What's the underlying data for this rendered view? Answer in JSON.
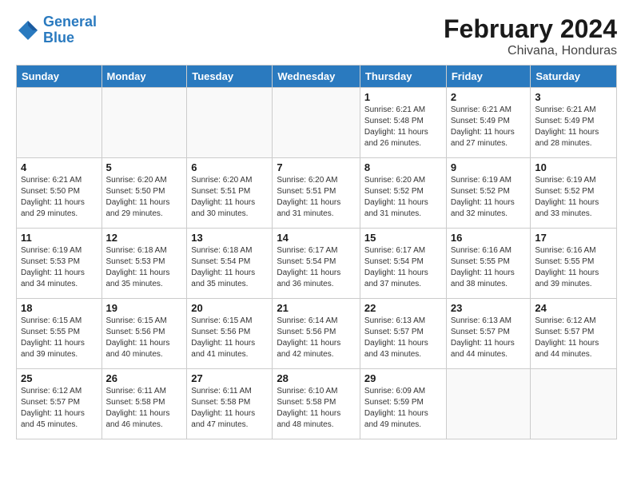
{
  "logo": {
    "line1": "General",
    "line2": "Blue"
  },
  "title": "February 2024",
  "subtitle": "Chivana, Honduras",
  "days_of_week": [
    "Sunday",
    "Monday",
    "Tuesday",
    "Wednesday",
    "Thursday",
    "Friday",
    "Saturday"
  ],
  "weeks": [
    [
      {
        "day": "",
        "info": ""
      },
      {
        "day": "",
        "info": ""
      },
      {
        "day": "",
        "info": ""
      },
      {
        "day": "",
        "info": ""
      },
      {
        "day": "1",
        "info": "Sunrise: 6:21 AM\nSunset: 5:48 PM\nDaylight: 11 hours and 26 minutes."
      },
      {
        "day": "2",
        "info": "Sunrise: 6:21 AM\nSunset: 5:49 PM\nDaylight: 11 hours and 27 minutes."
      },
      {
        "day": "3",
        "info": "Sunrise: 6:21 AM\nSunset: 5:49 PM\nDaylight: 11 hours and 28 minutes."
      }
    ],
    [
      {
        "day": "4",
        "info": "Sunrise: 6:21 AM\nSunset: 5:50 PM\nDaylight: 11 hours and 29 minutes."
      },
      {
        "day": "5",
        "info": "Sunrise: 6:20 AM\nSunset: 5:50 PM\nDaylight: 11 hours and 29 minutes."
      },
      {
        "day": "6",
        "info": "Sunrise: 6:20 AM\nSunset: 5:51 PM\nDaylight: 11 hours and 30 minutes."
      },
      {
        "day": "7",
        "info": "Sunrise: 6:20 AM\nSunset: 5:51 PM\nDaylight: 11 hours and 31 minutes."
      },
      {
        "day": "8",
        "info": "Sunrise: 6:20 AM\nSunset: 5:52 PM\nDaylight: 11 hours and 31 minutes."
      },
      {
        "day": "9",
        "info": "Sunrise: 6:19 AM\nSunset: 5:52 PM\nDaylight: 11 hours and 32 minutes."
      },
      {
        "day": "10",
        "info": "Sunrise: 6:19 AM\nSunset: 5:52 PM\nDaylight: 11 hours and 33 minutes."
      }
    ],
    [
      {
        "day": "11",
        "info": "Sunrise: 6:19 AM\nSunset: 5:53 PM\nDaylight: 11 hours and 34 minutes."
      },
      {
        "day": "12",
        "info": "Sunrise: 6:18 AM\nSunset: 5:53 PM\nDaylight: 11 hours and 35 minutes."
      },
      {
        "day": "13",
        "info": "Sunrise: 6:18 AM\nSunset: 5:54 PM\nDaylight: 11 hours and 35 minutes."
      },
      {
        "day": "14",
        "info": "Sunrise: 6:17 AM\nSunset: 5:54 PM\nDaylight: 11 hours and 36 minutes."
      },
      {
        "day": "15",
        "info": "Sunrise: 6:17 AM\nSunset: 5:54 PM\nDaylight: 11 hours and 37 minutes."
      },
      {
        "day": "16",
        "info": "Sunrise: 6:16 AM\nSunset: 5:55 PM\nDaylight: 11 hours and 38 minutes."
      },
      {
        "day": "17",
        "info": "Sunrise: 6:16 AM\nSunset: 5:55 PM\nDaylight: 11 hours and 39 minutes."
      }
    ],
    [
      {
        "day": "18",
        "info": "Sunrise: 6:15 AM\nSunset: 5:55 PM\nDaylight: 11 hours and 39 minutes."
      },
      {
        "day": "19",
        "info": "Sunrise: 6:15 AM\nSunset: 5:56 PM\nDaylight: 11 hours and 40 minutes."
      },
      {
        "day": "20",
        "info": "Sunrise: 6:15 AM\nSunset: 5:56 PM\nDaylight: 11 hours and 41 minutes."
      },
      {
        "day": "21",
        "info": "Sunrise: 6:14 AM\nSunset: 5:56 PM\nDaylight: 11 hours and 42 minutes."
      },
      {
        "day": "22",
        "info": "Sunrise: 6:13 AM\nSunset: 5:57 PM\nDaylight: 11 hours and 43 minutes."
      },
      {
        "day": "23",
        "info": "Sunrise: 6:13 AM\nSunset: 5:57 PM\nDaylight: 11 hours and 44 minutes."
      },
      {
        "day": "24",
        "info": "Sunrise: 6:12 AM\nSunset: 5:57 PM\nDaylight: 11 hours and 44 minutes."
      }
    ],
    [
      {
        "day": "25",
        "info": "Sunrise: 6:12 AM\nSunset: 5:57 PM\nDaylight: 11 hours and 45 minutes."
      },
      {
        "day": "26",
        "info": "Sunrise: 6:11 AM\nSunset: 5:58 PM\nDaylight: 11 hours and 46 minutes."
      },
      {
        "day": "27",
        "info": "Sunrise: 6:11 AM\nSunset: 5:58 PM\nDaylight: 11 hours and 47 minutes."
      },
      {
        "day": "28",
        "info": "Sunrise: 6:10 AM\nSunset: 5:58 PM\nDaylight: 11 hours and 48 minutes."
      },
      {
        "day": "29",
        "info": "Sunrise: 6:09 AM\nSunset: 5:59 PM\nDaylight: 11 hours and 49 minutes."
      },
      {
        "day": "",
        "info": ""
      },
      {
        "day": "",
        "info": ""
      }
    ]
  ]
}
